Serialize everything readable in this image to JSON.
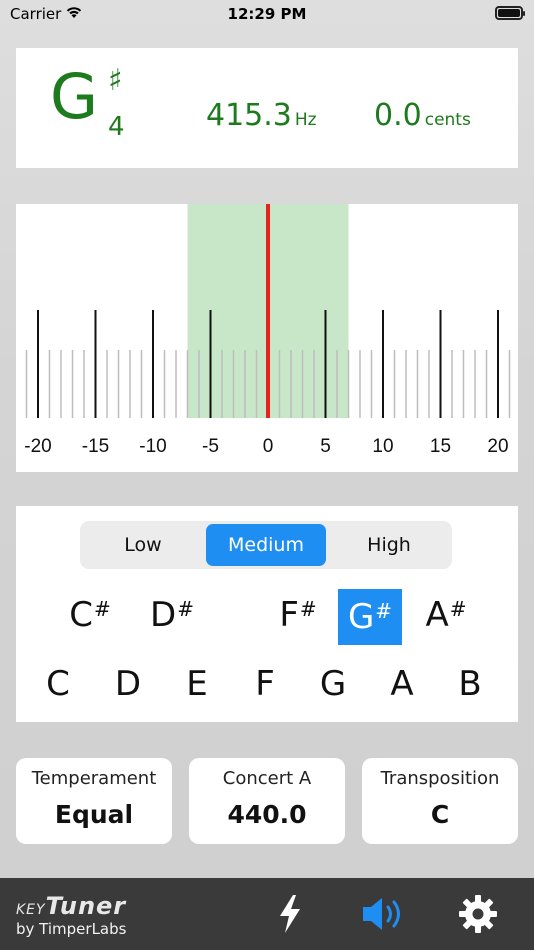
{
  "status_bar": {
    "carrier": "Carrier",
    "time": "12:29 PM"
  },
  "note_display": {
    "note": "G",
    "accidental": "♯",
    "octave": "4",
    "frequency": "415.3",
    "frequency_unit": "Hz",
    "cents": "0.0",
    "cents_unit": "cents"
  },
  "meter": {
    "ticks": [
      "-20",
      "-15",
      "-10",
      "-5",
      "0",
      "5",
      "10",
      "15",
      "20"
    ],
    "needle_cents": 0,
    "in_tune_zone_cents": [
      -7,
      7
    ],
    "in_tune_color": "#c8e6c8",
    "needle_color": "#e8231f"
  },
  "range_selector": {
    "options": [
      "Low",
      "Medium",
      "High"
    ],
    "selected": "Medium"
  },
  "sharp_keys": [
    {
      "letter": "C",
      "accidental": "#"
    },
    {
      "letter": "D",
      "accidental": "#"
    },
    {
      "letter": "F",
      "accidental": "#"
    },
    {
      "letter": "G",
      "accidental": "#",
      "selected": true
    },
    {
      "letter": "A",
      "accidental": "#"
    }
  ],
  "natural_keys": [
    "C",
    "D",
    "E",
    "F",
    "G",
    "A",
    "B"
  ],
  "settings": {
    "temperament": {
      "label": "Temperament",
      "value": "Equal"
    },
    "concert_a": {
      "label": "Concert A",
      "value": "440.0"
    },
    "transposition": {
      "label": "Transposition",
      "value": "C"
    }
  },
  "branding": {
    "key": "KEY",
    "tuner": "Tuner",
    "byline": "by TimperLabs"
  },
  "accent_color": "#1e8ef3",
  "note_color": "#1d7a1d",
  "toolbar_icons": [
    "lightning-icon",
    "speaker-icon",
    "gear-icon"
  ]
}
